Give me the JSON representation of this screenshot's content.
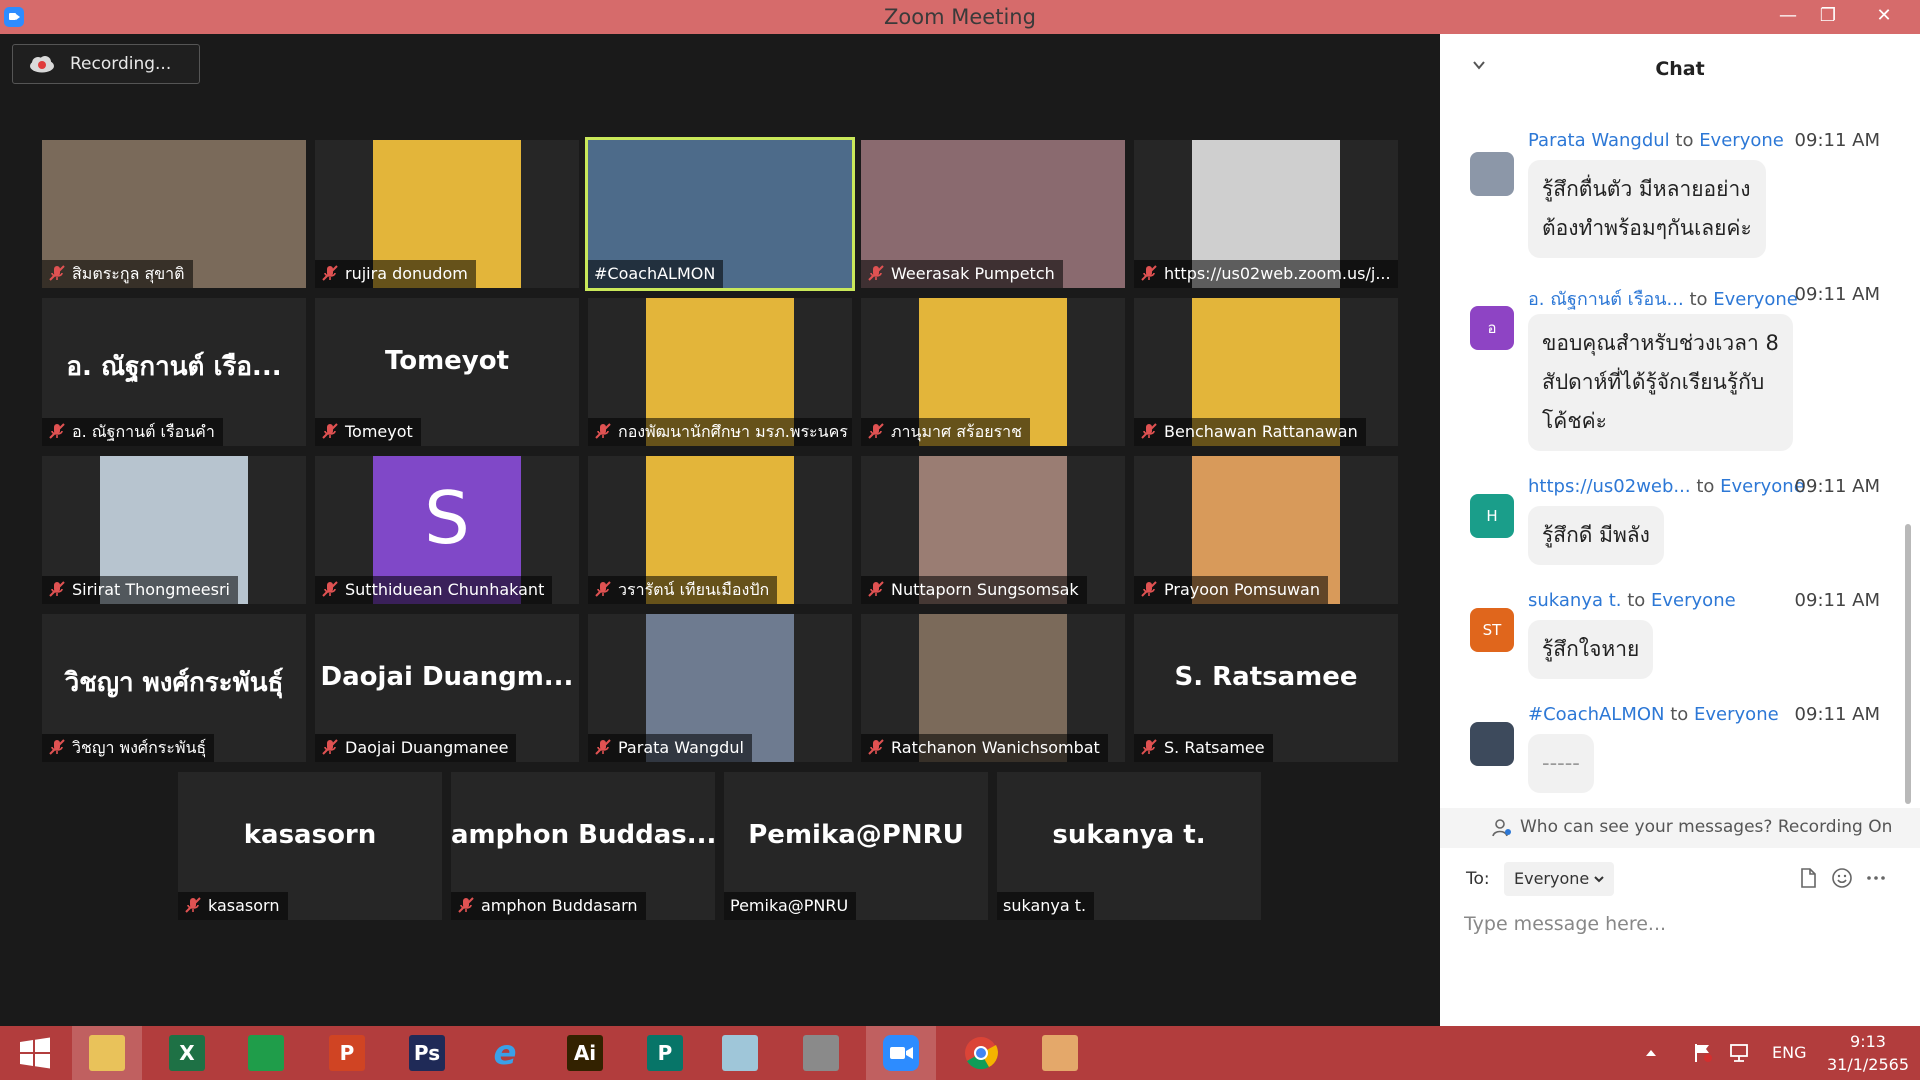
{
  "window": {
    "title": "Zoom Meeting",
    "minimize": "—",
    "restore": "❐",
    "close": "✕"
  },
  "recording": {
    "label": "Recording..."
  },
  "participants": [
    {
      "label": "สิมตระกูล สุขาติ",
      "big": "",
      "photo": "#7a6a5a",
      "muted": true
    },
    {
      "label": "rujira donudom",
      "big": "",
      "photo": "#e3b53a",
      "muted": true
    },
    {
      "label": "#CoachALMON",
      "big": "",
      "photo": "#4d6b8a",
      "muted": false
    },
    {
      "label": "Weerasak Pumpetch",
      "big": "",
      "photo": "#8a6a6f",
      "muted": true
    },
    {
      "label": "https://us02web.zoom.us/j...",
      "big": "",
      "photo": "#cfcfcf",
      "muted": true
    },
    {
      "label": "อ. ณัฐกานต์  เรือนคำ",
      "big": "อ. ณัฐกานต์  เรือ...",
      "photo": "",
      "muted": true
    },
    {
      "label": "Tomeyot",
      "big": "Tomeyot",
      "photo": "",
      "muted": true
    },
    {
      "label": "กองพัฒนานักศึกษา มรภ.พระนคร",
      "big": "",
      "photo": "#e3b53a",
      "muted": true
    },
    {
      "label": "ภานุมาศ สร้อยราช",
      "big": "",
      "photo": "#e3b53a",
      "muted": true
    },
    {
      "label": "Benchawan Rattanawan",
      "big": "",
      "photo": "#e3b53a",
      "muted": true
    },
    {
      "label": "Sirirat Thongmeesri",
      "big": "",
      "photo": "#b7c4cf",
      "muted": true
    },
    {
      "label": "Sutthiduean Chunhakant",
      "big": "",
      "photo": "#8048c8",
      "letter": "S",
      "muted": true
    },
    {
      "label": "วรารัตน์ เทียนเมืองปัก",
      "big": "",
      "photo": "#e3b53a",
      "muted": true
    },
    {
      "label": "Nuttaporn Sungsomsak",
      "big": "",
      "photo": "#9a7d73",
      "muted": true
    },
    {
      "label": "Prayoon Pomsuwan",
      "big": "",
      "photo": "#d89a5a",
      "muted": true
    },
    {
      "label": "วิชญา พงศ์กระพันธุ์",
      "big": "วิชญา พงศ์กระพันธุ์",
      "photo": "",
      "muted": true
    },
    {
      "label": "Daojai Duangmanee",
      "big": "Daojai  Duangm...",
      "photo": "",
      "muted": true
    },
    {
      "label": "Parata Wangdul",
      "big": "",
      "photo": "#6e7b90",
      "muted": true
    },
    {
      "label": "Ratchanon Wanichsombat",
      "big": "",
      "photo": "#7b6a5a",
      "muted": true
    },
    {
      "label": "S. Ratsamee",
      "big": "S. Ratsamee",
      "photo": "",
      "muted": true
    },
    {
      "label": "kasasorn",
      "big": "kasasorn",
      "photo": "",
      "muted": true
    },
    {
      "label": "amphon Buddasarn",
      "big": "amphon  Buddas...",
      "photo": "",
      "muted": true
    },
    {
      "label": "Pemika@PNRU",
      "big": "Pemika@PNRU",
      "photo": "",
      "muted": false
    },
    {
      "label": "sukanya t.",
      "big": "sukanya t.",
      "photo": "",
      "muted": false
    }
  ],
  "chat": {
    "title": "Chat",
    "messages": [
      {
        "sender": "Parata Wangdul",
        "to": "to",
        "target": "Everyone",
        "time": "09:11 AM",
        "avatar": "",
        "avatarColor": "#8c97a8",
        "lines": [
          "รู้สึกตื่นตัว มีหลายอย่าง",
          "ต้องทำพร้อมๆกันเลยค่ะ"
        ]
      },
      {
        "sender": "อ. ณัฐกานต์  เรือน...",
        "to": "to",
        "target": "Everyone",
        "time": "09:11 AM",
        "avatar": "อ",
        "avatarColor": "#8e44c4",
        "lines": [
          "ขอบคุณสำหรับช่วงเวลา 8",
          "สัปดาห์ที่ได้รู้จักเรียนรู้กับ",
          "โค้ชค่ะ"
        ]
      },
      {
        "sender": "https://us02web...",
        "to": "to",
        "target": "Everyone",
        "time": "09:11 AM",
        "avatar": "H",
        "avatarColor": "#1a9e8a",
        "lines": [
          "รู้สึกดี มีพลัง"
        ]
      },
      {
        "sender": "sukanya t.",
        "to": "to",
        "target": "Everyone",
        "time": "09:11 AM",
        "avatar": "ST",
        "avatarColor": "#e0661c",
        "lines": [
          "รู้สึกใจหาย"
        ]
      },
      {
        "sender": "#CoachALMON",
        "to": "to",
        "target": "Everyone",
        "time": "09:11 AM",
        "avatar": "",
        "avatarColor": "#3d4a5c",
        "lines": [
          "-----"
        ]
      }
    ],
    "privacy": "Who can see your messages? Recording On",
    "to_label": "To:",
    "to_value": "Everyone",
    "input_placeholder": "Type message here..."
  },
  "taskbar": {
    "apps": [
      {
        "name": "windows-start",
        "label": "",
        "color": ""
      },
      {
        "name": "file-explorer",
        "label": "",
        "color": "#e9c25a"
      },
      {
        "name": "excel",
        "label": "X",
        "color": "#1e7145"
      },
      {
        "name": "store",
        "label": "",
        "color": "#1f9d4a"
      },
      {
        "name": "powerpoint",
        "label": "P",
        "color": "#d04423"
      },
      {
        "name": "photoshop",
        "label": "Ps",
        "color": "#1f2a57"
      },
      {
        "name": "internet-explorer",
        "label": "e",
        "color": ""
      },
      {
        "name": "illustrator",
        "label": "Ai",
        "color": "#332200"
      },
      {
        "name": "publisher",
        "label": "P",
        "color": "#077568"
      },
      {
        "name": "notes",
        "label": "",
        "color": "#9fc6d9"
      },
      {
        "name": "hoto-cape",
        "label": "",
        "color": "#8a8a8a"
      },
      {
        "name": "zoom",
        "label": "",
        "color": "#2d8cff"
      },
      {
        "name": "chrome",
        "label": "",
        "color": ""
      },
      {
        "name": "photo-app",
        "label": "",
        "color": "#e4a86a"
      }
    ],
    "lang": "ENG",
    "time": "9:13",
    "date": "31/1/2565"
  }
}
